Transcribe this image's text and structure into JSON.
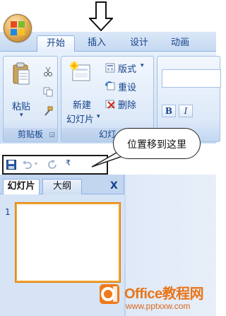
{
  "ribbon": {
    "tabs": [
      {
        "label": "开始",
        "active": true
      },
      {
        "label": "插入"
      },
      {
        "label": "设计"
      },
      {
        "label": "动画"
      }
    ],
    "clipboard": {
      "paste_label": "粘贴",
      "group_label": "剪贴板",
      "launcher_icon": "dialog-launcher-icon"
    },
    "slides": {
      "new_slide_label_line1": "新建",
      "new_slide_label_line2": "幻灯片",
      "layout_label": "版式",
      "reset_label": "重设",
      "delete_label": "删除",
      "group_label": "幻灯"
    },
    "font": {
      "bold_label": "B",
      "italic_label": "I"
    }
  },
  "quick_access_toolbar": {
    "icons": [
      "save-icon",
      "undo-icon",
      "redo-icon",
      "customize-dropdown-icon"
    ]
  },
  "annotation": {
    "callout_text": "位置移到这里",
    "arrow": "down-arrow"
  },
  "slide_pane": {
    "tabs": [
      {
        "label": "幻灯片",
        "active": true
      },
      {
        "label": "大纲"
      }
    ],
    "close_label": "X",
    "slide_number": "1"
  },
  "watermark": {
    "title": "Office教程网",
    "url": "www.pptxxw.com"
  },
  "colors": {
    "ribbon_text": "#15428b",
    "ribbon_bg": "#dbe8f8",
    "selection_border": "#f0a430",
    "watermark": "#e8751a"
  }
}
